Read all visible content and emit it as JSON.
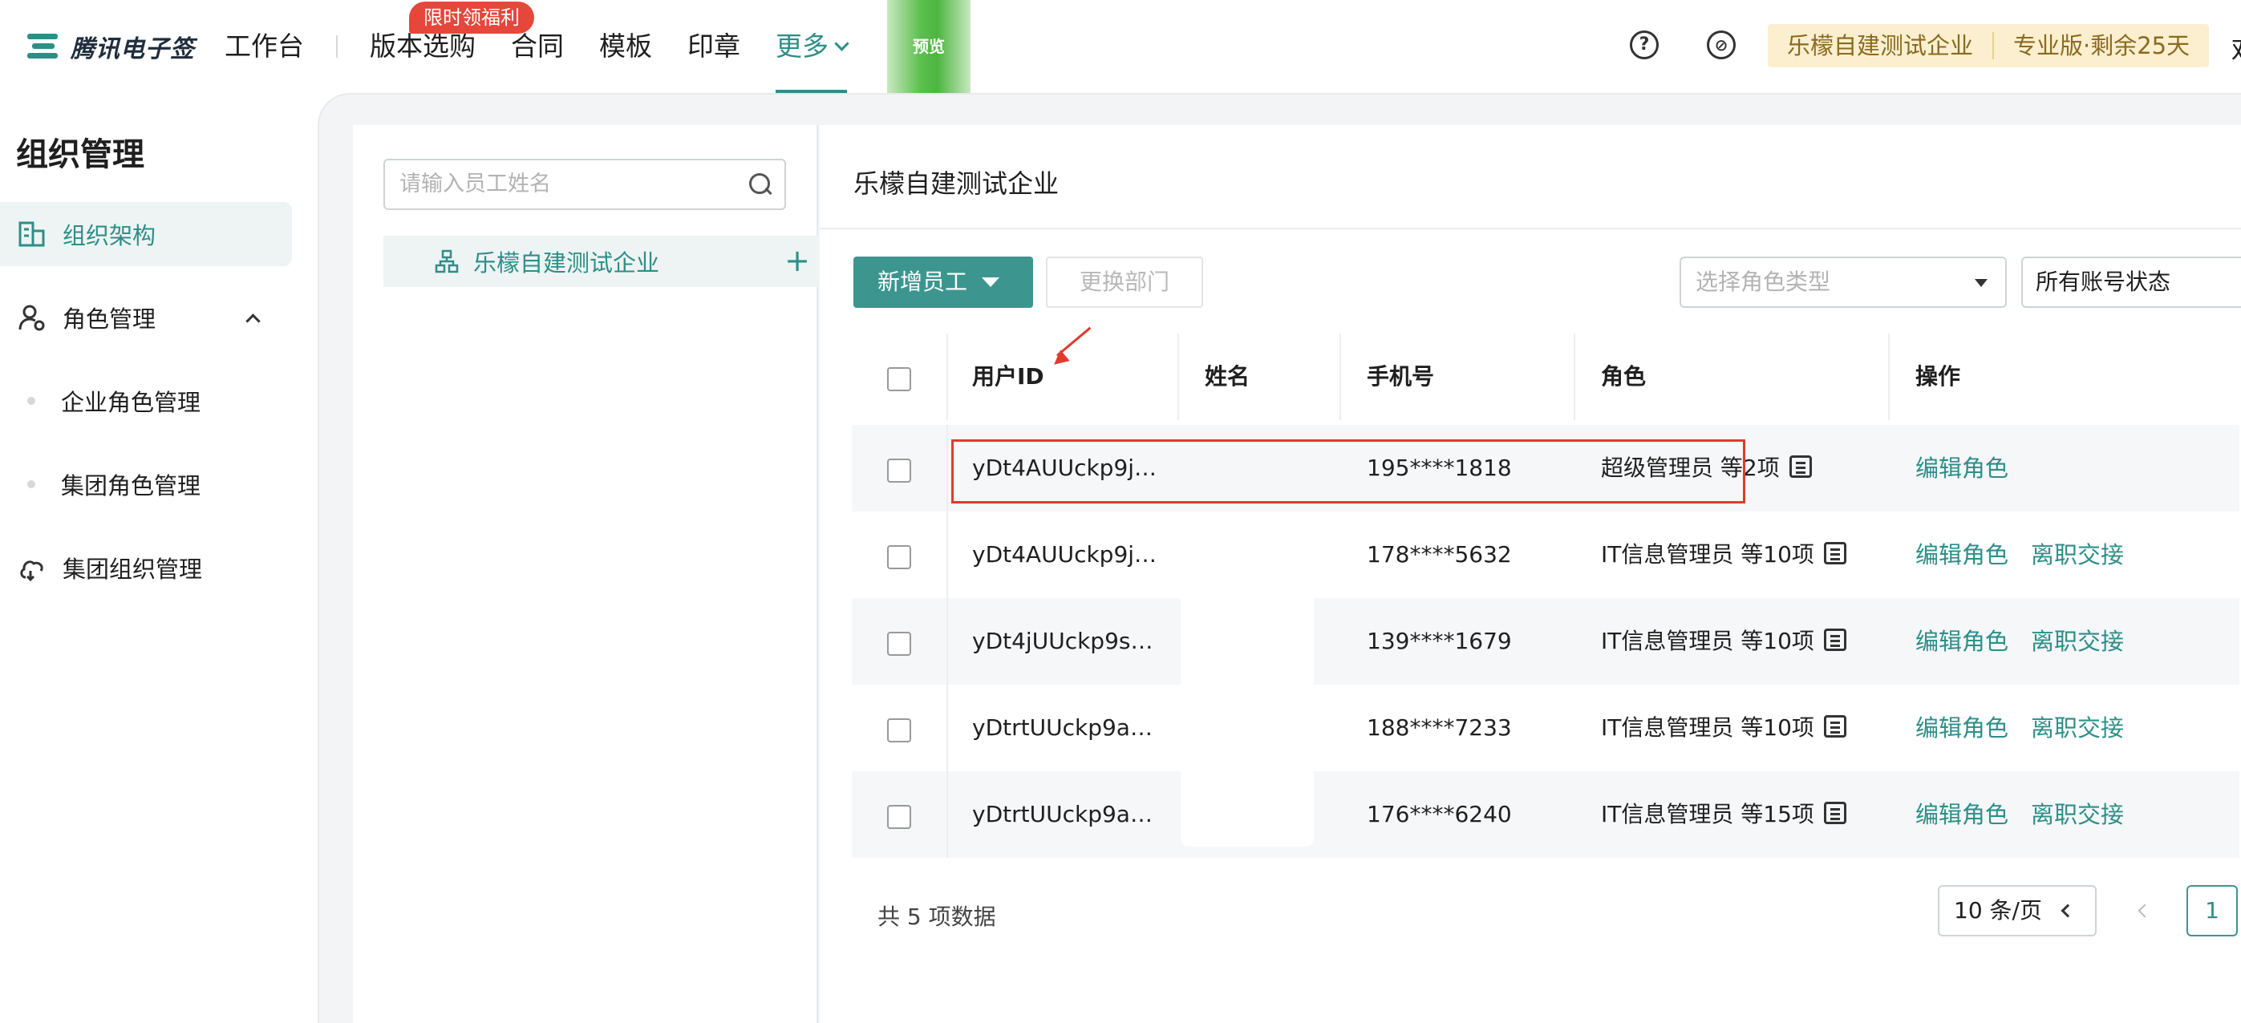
{
  "header": {
    "logo_text": "腾讯电子签",
    "nav": [
      "工作台",
      "版本选购",
      "合同",
      "模板",
      "印章",
      "更多"
    ],
    "promo_badge": "限时领福利",
    "preview_label": "预览",
    "company": "乐檬自建测试企业",
    "plan": "专业版·剩余25天",
    "cut_char": "欢"
  },
  "sidebar": {
    "title": "组织管理",
    "items": [
      {
        "label": "组织架构",
        "icon": "building-icon",
        "active": true
      },
      {
        "label": "角色管理",
        "icon": "user-settings-icon"
      },
      {
        "label": "企业角色管理",
        "sub": true
      },
      {
        "label": "集团角色管理",
        "sub": true
      },
      {
        "label": "集团组织管理",
        "icon": "group-org-icon"
      }
    ]
  },
  "tree": {
    "search_placeholder": "请输入员工姓名",
    "root_node": "乐檬自建测试企业",
    "add_symbol": "+"
  },
  "main": {
    "title": "乐檬自建测试企业",
    "add_employee": "新增员工",
    "change_dept": "更换部门",
    "role_type_placeholder": "选择角色类型",
    "account_status": "所有账号状态",
    "columns": [
      "用户ID",
      "姓名",
      "手机号",
      "角色",
      "操作"
    ],
    "rows": [
      {
        "id": "yDt4AUUckp9j…",
        "name": "",
        "phone": "195****1818",
        "role": "超级管理员 等2项",
        "actions": [
          "编辑角色"
        ]
      },
      {
        "id": "yDt4AUUckp9j…",
        "name": "",
        "phone": "178****5632",
        "role": "IT信息管理员 等10项",
        "actions": [
          "编辑角色",
          "离职交接"
        ]
      },
      {
        "id": "yDt4jUUckp9s…",
        "name": "",
        "phone": "139****1679",
        "role": "IT信息管理员 等10项",
        "actions": [
          "编辑角色",
          "离职交接"
        ]
      },
      {
        "id": "yDtrtUUckp9a…",
        "name": "",
        "phone": "188****7233",
        "role": "IT信息管理员 等10项",
        "actions": [
          "编辑角色",
          "离职交接"
        ]
      },
      {
        "id": "yDtrtUUckp9a…",
        "name": "",
        "phone": "176****6240",
        "role": "IT信息管理员 等15项",
        "actions": [
          "编辑角色",
          "离职交接"
        ]
      }
    ],
    "total": "共 5 项数据",
    "page_size": "10 条/页",
    "current_page": "1"
  },
  "colors": {
    "accent": "#2d8e88",
    "annotation": "#e23a2d",
    "plan_bg": "#fcefcf"
  }
}
